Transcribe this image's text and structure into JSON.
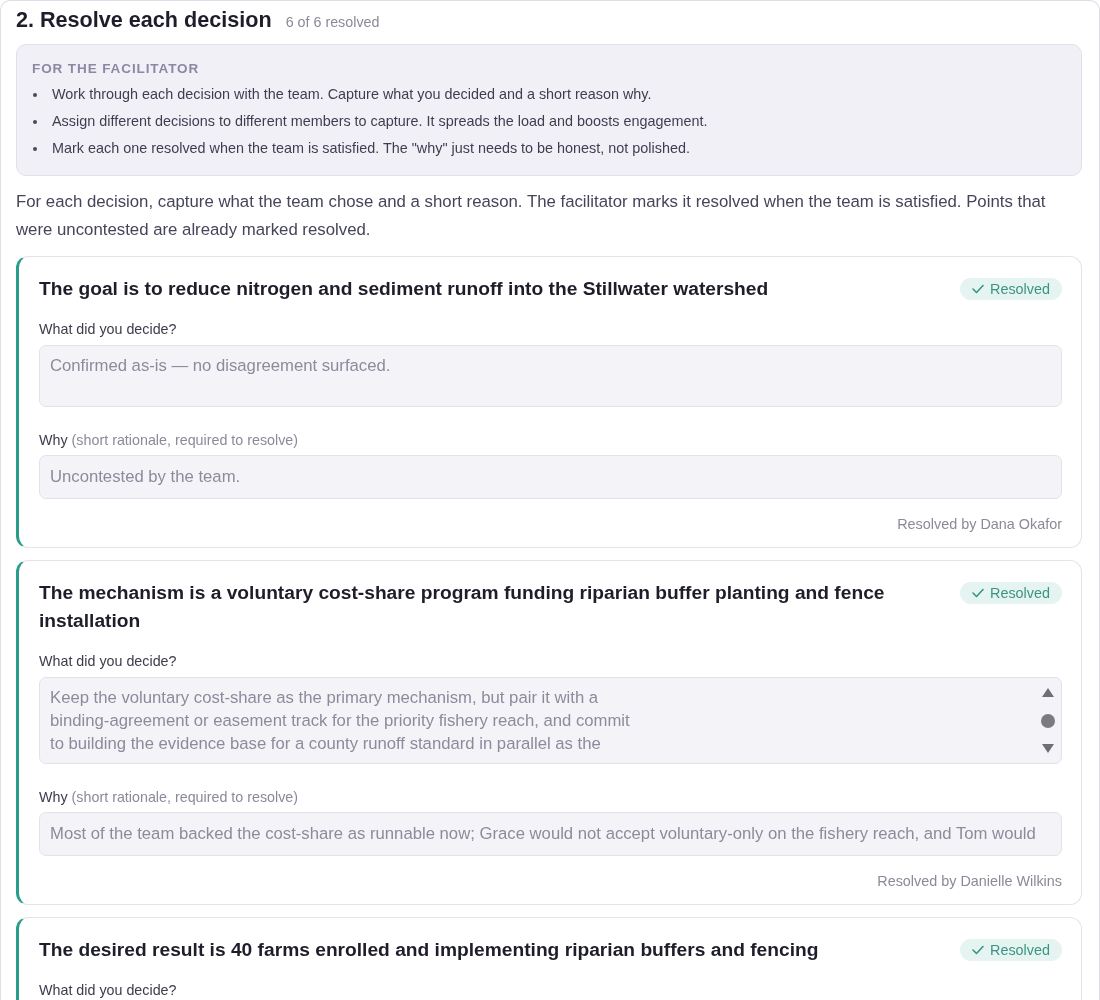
{
  "section": {
    "title": "2. Resolve each decision",
    "progress": "6 of 6 resolved"
  },
  "facilitator_note": {
    "heading": "FOR THE FACILITATOR",
    "items": [
      "Work through each decision with the team. Capture what you decided and a short reason why.",
      "Assign different decisions to different members to capture. It spreads the load and boosts engagement.",
      "Mark each one resolved when the team is satisfied. The \"why\" just needs to be honest, not polished."
    ]
  },
  "intro": "For each decision, capture what the team chose and a short reason. The facilitator marks it resolved when the team is satisfied. Points that were uncontested are already marked resolved.",
  "decisions": [
    {
      "title": "The goal is to reduce nitrogen and sediment runoff into the Stillwater watershed",
      "resolved": true,
      "status": "Resolved",
      "decide": {
        "label": "What did you decide?",
        "value": "Confirmed as-is — no disagreement surfaced.",
        "scrollbar": false
      },
      "why": {
        "label": "Why",
        "hint": "(short rationale, required to resolve)",
        "value": "Uncontested by the team."
      },
      "resolved_by": "Resolved by Dana Okafor"
    },
    {
      "title": "The mechanism is a voluntary cost-share program funding riparian buffer planting and fence installation",
      "resolved": true,
      "status": "Resolved",
      "decide": {
        "label": "What did you decide?",
        "value": "Keep the voluntary cost-share as the primary mechanism, but pair it with a\nbinding-agreement or easement track for the priority fishery reach, and commit\nto building the evidence base for a county runoff standard in parallel as the",
        "scrollbar": true
      },
      "why": {
        "label": "Why",
        "hint": "(short rationale, required to resolve)",
        "value": "Most of the team backed the cost-share as runnable now; Grace would not accept voluntary-only on the fishery reach, and Tom would"
      },
      "resolved_by": "Resolved by Danielle Wilkins"
    },
    {
      "title": "The desired result is 40 farms enrolled and implementing riparian buffers and fencing",
      "resolved": true,
      "status": "Resolved",
      "decide": {
        "label": "What did you decide?"
      }
    }
  ]
}
